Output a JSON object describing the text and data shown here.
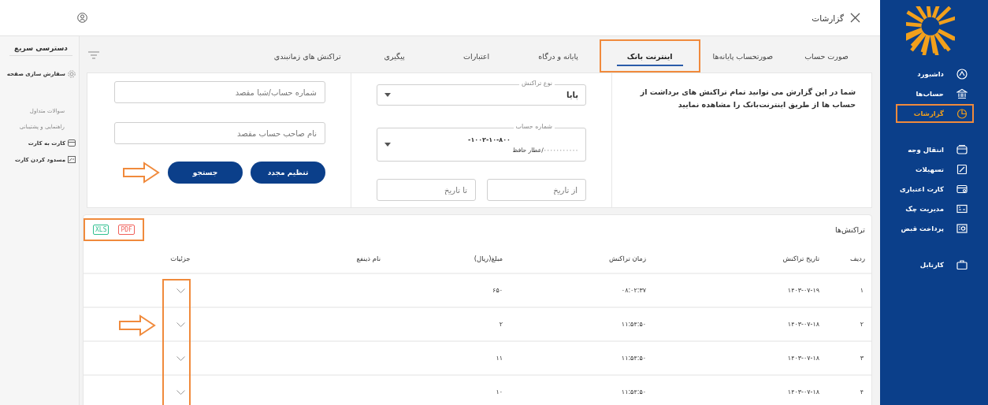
{
  "header": {
    "title": "گزارشات"
  },
  "sidebar": {
    "groups": [
      [
        {
          "label": "داشبورد",
          "selected": false,
          "highlighted": false
        },
        {
          "label": "حساب‌ها",
          "selected": false,
          "highlighted": false
        },
        {
          "label": "گزارشات",
          "selected": true,
          "highlighted": true
        }
      ],
      [
        {
          "label": "انتقال وجه",
          "selected": false,
          "highlighted": false
        },
        {
          "label": "تسهیلات",
          "selected": false,
          "highlighted": false
        },
        {
          "label": "کارت اعتباری",
          "selected": false,
          "highlighted": false
        },
        {
          "label": "مدیریت چک",
          "selected": false,
          "highlighted": false
        },
        {
          "label": "پرداخت قبض",
          "selected": false,
          "highlighted": false
        }
      ],
      [
        {
          "label": "کارتابل",
          "selected": false,
          "highlighted": false
        }
      ]
    ]
  },
  "quick_access": {
    "title": "دسترسی سریع",
    "items": [
      {
        "label": "سفارش سازی صفحه",
        "disabled": false
      },
      {
        "label": "سوالات متداول",
        "disabled": true
      },
      {
        "label": "راهنمایی و پشتیبانی",
        "disabled": true
      },
      {
        "label": "کارت به کارت",
        "disabled": false
      },
      {
        "label": "مسدود کردن کارت",
        "disabled": false
      }
    ]
  },
  "tabs": [
    {
      "label": "صورت حساب",
      "selected": false,
      "highlighted": false
    },
    {
      "label": "صورتحساب پایانه‌ها",
      "selected": false,
      "highlighted": false
    },
    {
      "label": "اینترنت بانک",
      "selected": true,
      "highlighted": true
    },
    {
      "label": "پایانه و درگاه",
      "selected": false,
      "highlighted": false
    },
    {
      "label": "اعتبارات",
      "selected": false,
      "highlighted": false
    },
    {
      "label": "پیگیری",
      "selected": false,
      "highlighted": false
    },
    {
      "label": "تراکنش های زمانبندی",
      "selected": false,
      "highlighted": false
    }
  ],
  "filters": {
    "description": "شما در این گزارش می توانید تمام تراکنش های برداشت از حساب ها از طریق اینترنت‌بانک را مشاهده نمایید",
    "transaction_type": {
      "label": "نوع تراکنش",
      "value": "پایا"
    },
    "account": {
      "label": "شماره حساب",
      "number": "۱۰۰۲-۱۰-۸۰۰-",
      "owner": "۰۰۰۰۰۰۰۰۰۰۰/عطار حافظ"
    },
    "from_date": {
      "placeholder": "از تاریخ"
    },
    "to_date": {
      "placeholder": "تا تاریخ"
    },
    "destination_account": {
      "placeholder": "شماره حساب/شبا مقصد"
    },
    "destination_owner": {
      "placeholder": "نام صاحب حساب مقصد"
    },
    "buttons": [
      {
        "label": "تنظیم مجدد",
        "arrow_marked": false
      },
      {
        "label": "جستجو",
        "arrow_marked": true
      }
    ]
  },
  "table": {
    "title": "تراکنش‌ها",
    "export_highlighted": true,
    "exports": [
      {
        "label": "PDF",
        "color": "#f0605a"
      },
      {
        "label": "XLS",
        "color": "#2fbf8f"
      }
    ],
    "columns": [
      "ردیف",
      "تاریخ تراکنش",
      "زمان تراکنش",
      "مبلغ(ریال)",
      "نام ذینفع",
      "جزئیات"
    ],
    "details_highlighted": true,
    "rows": [
      {
        "cells": [
          "۱",
          "۱۴۰۳-۰۷-۱۹",
          "۰۸:۰۲:۳۷",
          "۶۵۰"
        ],
        "arrow_marked": false
      },
      {
        "cells": [
          "۲",
          "۱۴۰۳-۰۷-۱۸",
          "۱۱:۵۴:۵۰",
          "۲"
        ],
        "arrow_marked": true
      },
      {
        "cells": [
          "۳",
          "۱۴۰۳-۰۷-۱۸",
          "۱۱:۵۴:۵۰",
          "۱۱"
        ],
        "arrow_marked": false
      },
      {
        "cells": [
          "۴",
          "۱۴۰۳-۰۷-۱۸",
          "۱۱:۵۴:۵۰",
          "۱۰"
        ],
        "arrow_marked": false
      }
    ]
  }
}
